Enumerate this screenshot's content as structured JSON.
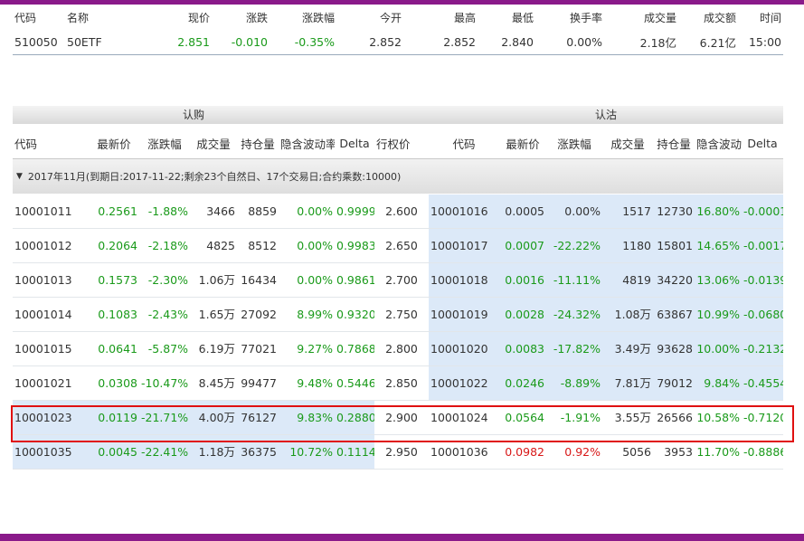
{
  "quote": {
    "headers": [
      "代码",
      "名称",
      "现价",
      "涨跌",
      "涨跌幅",
      "今开",
      "最高",
      "最低",
      "换手率",
      "成交量",
      "成交额",
      "时间"
    ],
    "values": [
      "510050",
      "50ETF",
      "2.851",
      "-0.010",
      "-0.35%",
      "2.852",
      "2.852",
      "2.840",
      "0.00%",
      "2.18亿",
      "6.21亿",
      "15:00"
    ]
  },
  "sections": {
    "call": "认购",
    "put": "认沽"
  },
  "columns": {
    "call": [
      "代码",
      "最新价",
      "涨跌幅",
      "成交量",
      "持仓量",
      "隐含波动率",
      "Delta"
    ],
    "strike": "行权价",
    "put": [
      "代码",
      "最新价",
      "涨跌幅",
      "成交量",
      "持仓量",
      "隐含波动率",
      "Delta"
    ]
  },
  "group": {
    "label": "2017年11月(到期日:2017-11-22;剩余23个自然日、17个交易日;合约乘数:10000)"
  },
  "rows": [
    {
      "call": [
        "10001011",
        "0.2561",
        "-1.88%",
        "3466",
        "8859",
        "0.00%",
        "0.9999"
      ],
      "strike": "2.600",
      "put": [
        "10001016",
        "0.0005",
        "0.00%",
        "1517",
        "12730",
        "16.80%",
        "-0.0001"
      ]
    },
    {
      "call": [
        "10001012",
        "0.2064",
        "-2.18%",
        "4825",
        "8512",
        "0.00%",
        "0.9983"
      ],
      "strike": "2.650",
      "put": [
        "10001017",
        "0.0007",
        "-22.22%",
        "1180",
        "15801",
        "14.65%",
        "-0.0017"
      ]
    },
    {
      "call": [
        "10001013",
        "0.1573",
        "-2.30%",
        "1.06万",
        "16434",
        "0.00%",
        "0.9861"
      ],
      "strike": "2.700",
      "put": [
        "10001018",
        "0.0016",
        "-11.11%",
        "4819",
        "34220",
        "13.06%",
        "-0.0139"
      ]
    },
    {
      "call": [
        "10001014",
        "0.1083",
        "-2.43%",
        "1.65万",
        "27092",
        "8.99%",
        "0.9320"
      ],
      "strike": "2.750",
      "put": [
        "10001019",
        "0.0028",
        "-24.32%",
        "1.08万",
        "63867",
        "10.99%",
        "-0.0680"
      ]
    },
    {
      "call": [
        "10001015",
        "0.0641",
        "-5.87%",
        "6.19万",
        "77021",
        "9.27%",
        "0.7868"
      ],
      "strike": "2.800",
      "put": [
        "10001020",
        "0.0083",
        "-17.82%",
        "3.49万",
        "93628",
        "10.00%",
        "-0.2132"
      ]
    },
    {
      "call": [
        "10001021",
        "0.0308",
        "-10.47%",
        "8.45万",
        "99477",
        "9.48%",
        "0.5446"
      ],
      "strike": "2.850",
      "put": [
        "10001022",
        "0.0246",
        "-8.89%",
        "7.81万",
        "79012",
        "9.84%",
        "-0.4554"
      ]
    },
    {
      "call": [
        "10001023",
        "0.0119",
        "-21.71%",
        "4.00万",
        "76127",
        "9.83%",
        "0.2880"
      ],
      "strike": "2.900",
      "put": [
        "10001024",
        "0.0564",
        "-1.91%",
        "3.55万",
        "26566",
        "10.58%",
        "-0.7120"
      ]
    },
    {
      "call": [
        "10001035",
        "0.0045",
        "-22.41%",
        "1.18万",
        "36375",
        "10.72%",
        "0.1114"
      ],
      "strike": "2.950",
      "put": [
        "10001036",
        "0.0982",
        "0.92%",
        "5056",
        "3953",
        "11.70%",
        "-0.8886"
      ]
    }
  ],
  "colors": {
    "call_itm_bg": "#dce9f8",
    "put_itm_bg": "#dce9f8",
    "up": "#d81818",
    "down": "#1a9a1a",
    "highlight_border": "#e01010",
    "frame": "#8a1a8a"
  },
  "selected_row_index": 5
}
